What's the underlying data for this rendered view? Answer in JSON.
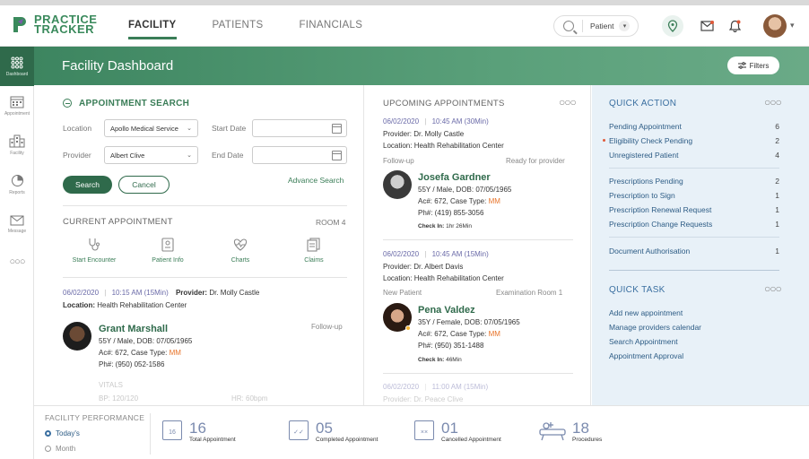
{
  "app": {
    "name_line1": "PRACTICE",
    "name_line2": "TRACKER"
  },
  "nav": [
    {
      "label": "FACILITY"
    },
    {
      "label": "PATIENTS"
    },
    {
      "label": "FINANCIALS"
    }
  ],
  "search": {
    "filter": "Patient"
  },
  "rail": [
    {
      "label": "Dashboard"
    },
    {
      "label": "Appointment"
    },
    {
      "label": "Facility"
    },
    {
      "label": "Reports"
    },
    {
      "label": "Message"
    }
  ],
  "page_title": "Facility Dashboard",
  "filters_label": "Filters",
  "appointment_search": {
    "title": "APPOINTMENT SEARCH",
    "location_label": "Location",
    "location_value": "Apollo Medical Service",
    "provider_label": "Provider",
    "provider_value": "Albert Clive",
    "start_date_label": "Start Date",
    "end_date_label": "End Date",
    "search_btn": "Search",
    "cancel_btn": "Cancel",
    "advance_link": "Advance Search"
  },
  "current": {
    "title": "CURRENT APPOINTMENT",
    "room": "ROOM 4",
    "actions": [
      {
        "label": "Start Encounter"
      },
      {
        "label": "Patient Info"
      },
      {
        "label": "Charts"
      },
      {
        "label": "Claims"
      }
    ],
    "date": "06/02/2020",
    "time": "10:15 AM (15Min)",
    "provider_label": "Provider:",
    "provider_name": "Dr. Molly Castle",
    "location_label": "Location:",
    "location_name": "Health Rehabilitation Center",
    "patient_name": "Grant Marshall",
    "status": "Follow-up",
    "demo": "55Y / Male, DOB: 07/05/1965",
    "ac_prefix": "Ac#: 672, Case Type:",
    "case_type": "MM",
    "phone": "Ph#: (950) 052-1586",
    "vitals": "VITALS",
    "bp": "BP: 120/120",
    "hr": "HR: 60bpm"
  },
  "upcoming": {
    "title": "UPCOMING APPOINTMENTS",
    "items": [
      {
        "date": "06/02/2020",
        "time": "10:45 AM (30Min)",
        "provider": "Provider: Dr. Molly Castle",
        "location": "Location: Health Rehabilitation Center",
        "status_left": "Follow-up",
        "status_right": "Ready for provider",
        "name": "Josefa Gardner",
        "demo": "55Y / Male, DOB: 07/05/1965",
        "ac_prefix": "Ac#: 672, Case Type:",
        "case_type": "MM",
        "phone": "Ph#: (419) 855-3056",
        "checkin_label": "Check In:",
        "checkin_value": "1hr 26Min"
      },
      {
        "date": "06/02/2020",
        "time": "10:45 AM (15Min)",
        "provider": "Provider: Dr. Albert Davis",
        "location": "Location: Health Rehabilitation Center",
        "status_left": "New Patient",
        "status_right": "Examination Room 1",
        "name": "Pena Valdez",
        "demo": "35Y / Female, DOB: 07/05/1965",
        "ac_prefix": "Ac#: 672, Case Type:",
        "case_type": "MM",
        "phone": "Ph#: (950) 351-1488",
        "checkin_label": "Check In:",
        "checkin_value": "46Min"
      }
    ],
    "next_date": "06/02/2020",
    "next_time": "11:00 AM (15Min)",
    "next_provider": "Provider: Dr. Peace Clive"
  },
  "quick_action": {
    "title": "QUICK ACTION",
    "items": [
      {
        "label": "Pending Appointment",
        "count": "6"
      },
      {
        "label": "Eligibility Check Pending",
        "count": "2"
      },
      {
        "label": "Unregistered Patient",
        "count": "4"
      },
      {
        "label": "Prescriptions Pending",
        "count": "2"
      },
      {
        "label": "Prescription to Sign",
        "count": "1"
      },
      {
        "label": "Prescription Renewal Request",
        "count": "1"
      },
      {
        "label": "Prescription Change Requests",
        "count": "1"
      },
      {
        "label": "Document Authorisation",
        "count": "1"
      }
    ]
  },
  "quick_task": {
    "title": "QUICK TASK",
    "items": [
      {
        "label": "Add new appointment"
      },
      {
        "label": "Manage providers calendar"
      },
      {
        "label": "Search Appointment"
      },
      {
        "label": "Appointment Approval"
      }
    ]
  },
  "performance": {
    "title": "FACILITY PERFORMANCE",
    "today": "Today's",
    "month": "Month",
    "stats": [
      {
        "num": "16",
        "label": "Total Appointment",
        "icon_text": "16"
      },
      {
        "num": "05",
        "label": "Completed Appointment"
      },
      {
        "num": "01",
        "label": "Cancelled Appointment"
      },
      {
        "num": "18",
        "label": "Procedures"
      }
    ]
  },
  "colors": {
    "brand": "#3a7d57",
    "accent_blue": "#3a6fa0",
    "orange": "#e8742a"
  }
}
